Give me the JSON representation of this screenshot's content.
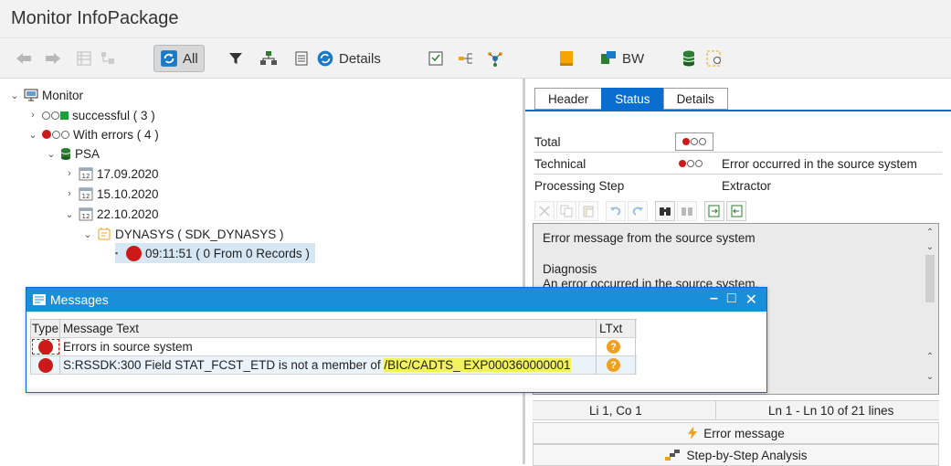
{
  "window": {
    "title": "Monitor InfoPackage"
  },
  "toolbar": {
    "all_label": "All",
    "details_label": "Details",
    "bw_label": "BW"
  },
  "tree": {
    "root": "Monitor",
    "successful": "successful ( 3 )",
    "with_errors": "With errors ( 4 )",
    "psa": "PSA",
    "dates": [
      "17.09.2020",
      "15.10.2020",
      "22.10.2020"
    ],
    "source": "DYNASYS ( SDK_DYNASYS )",
    "request": "09:11:51 ( 0 From 0 Records )"
  },
  "panel": {
    "tabs": [
      "Header",
      "Status",
      "Details"
    ],
    "total_label": "Total",
    "technical_label": "Technical",
    "technical_text": "Error occurred in the source system",
    "processing_step_label": "Processing Step",
    "extractor_label": "Extractor",
    "text_lines": [
      "Error message from the source system",
      "Diagnosis",
      "An error occurred in the source system."
    ],
    "cursor_pos": "Li 1, Co 1",
    "lines_info": "Ln 1 - Ln 10 of 21 lines",
    "error_btn": "Error message",
    "step_btn": "Step-by-Step Analysis"
  },
  "dialog": {
    "title": "Messages",
    "col_type": "Type",
    "col_text": "Message Text",
    "col_ltxt": "LTxt",
    "rows": [
      {
        "text": "Errors in source system"
      },
      {
        "text_plain": "S:RSSDK:300 Field STAT_FCST_ETD is not a member of ",
        "text_hl": "/BIC/CADTS_ EXP000360000001"
      }
    ]
  },
  "colors": {
    "accent": "#0a6ed1",
    "error": "#cc1a1a",
    "success": "#1f9e3e",
    "warning": "#f0a020",
    "highlight": "#f2f25a"
  }
}
